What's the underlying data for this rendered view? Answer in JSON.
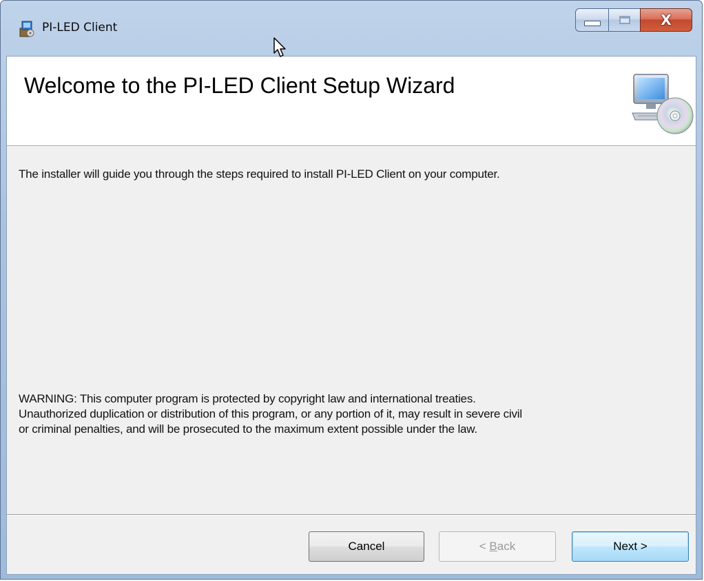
{
  "window": {
    "title": "PI-LED Client",
    "close_glyph": "X"
  },
  "banner": {
    "title": "Welcome to the PI-LED Client Setup Wizard",
    "icon": "computer-cd-icon"
  },
  "body": {
    "intro": "The installer will guide you through the steps required to install PI-LED Client on your computer.",
    "warning_lines": [
      "WARNING: This computer program is protected by copyright law and international treaties.",
      "Unauthorized duplication or distribution of this program, or any portion of it, may result in severe civil",
      "or criminal penalties, and will be prosecuted to the maximum extent possible under the law."
    ]
  },
  "buttons": {
    "cancel": "Cancel",
    "back_prefix": "< ",
    "back_accel": "B",
    "back_rest": "ack",
    "next": "Next >"
  },
  "colors": {
    "title_bar": "#a9c2e0",
    "close_button": "#c14a2f",
    "client_bg": "#f0f0f0",
    "default_button": "#bee6fd"
  }
}
